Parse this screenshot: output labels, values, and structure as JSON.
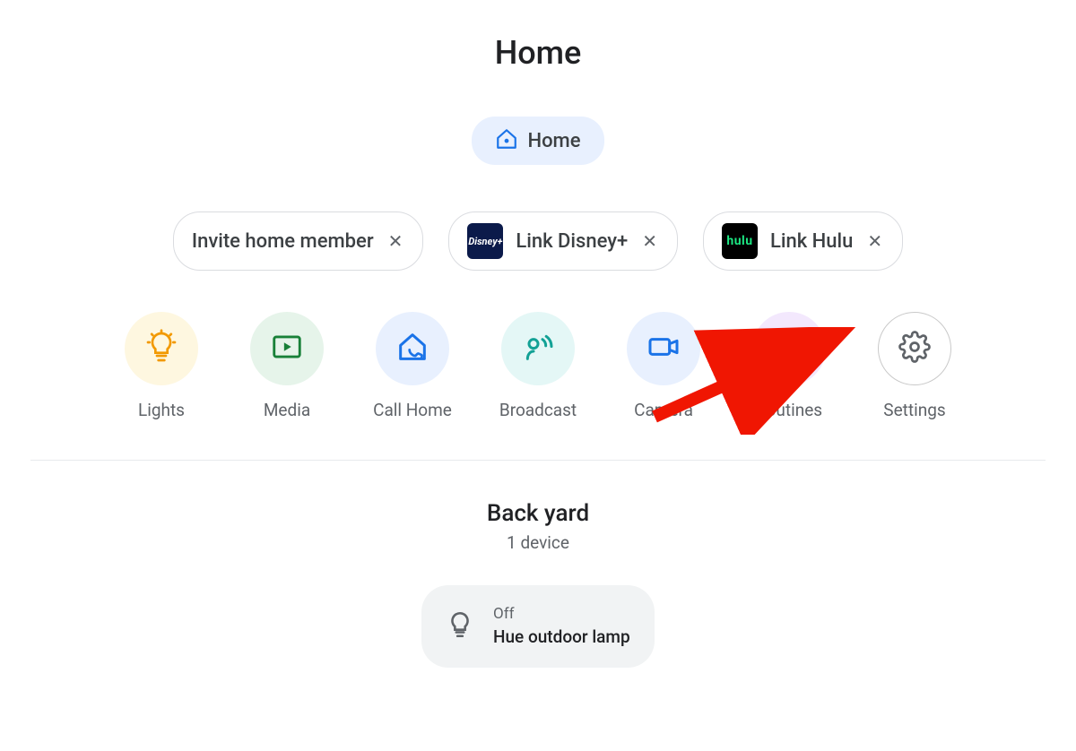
{
  "title": "Home",
  "home_selector": {
    "label": "Home"
  },
  "suggestions": [
    {
      "label": "Invite home member",
      "service": null
    },
    {
      "label": "Link Disney+",
      "service": "disney"
    },
    {
      "label": "Link Hulu",
      "service": "hulu"
    }
  ],
  "actions": [
    {
      "label": "Lights",
      "icon": "lightbulb-icon",
      "tint": "yellow"
    },
    {
      "label": "Media",
      "icon": "play-square-icon",
      "tint": "green"
    },
    {
      "label": "Call Home",
      "icon": "home-phone-icon",
      "tint": "blue"
    },
    {
      "label": "Broadcast",
      "icon": "broadcast-icon",
      "tint": "teal"
    },
    {
      "label": "Camera",
      "icon": "camera-icon",
      "tint": "blue"
    },
    {
      "label": "Routines",
      "icon": "routines-icon",
      "tint": "purple"
    },
    {
      "label": "Settings",
      "icon": "gear-icon",
      "tint": "outline"
    }
  ],
  "room": {
    "name": "Back yard",
    "subtitle": "1 device",
    "devices": [
      {
        "state": "Off",
        "name": "Hue outdoor lamp",
        "icon": "bulb-outline-icon"
      }
    ]
  },
  "colors": {
    "accent_blue": "#1a73e8",
    "text_primary": "#202124",
    "text_secondary": "#5f6368",
    "chip_bg": "#e8f0fe",
    "annotation_red": "#f01602"
  },
  "annotation": {
    "target_action_index": 6
  }
}
